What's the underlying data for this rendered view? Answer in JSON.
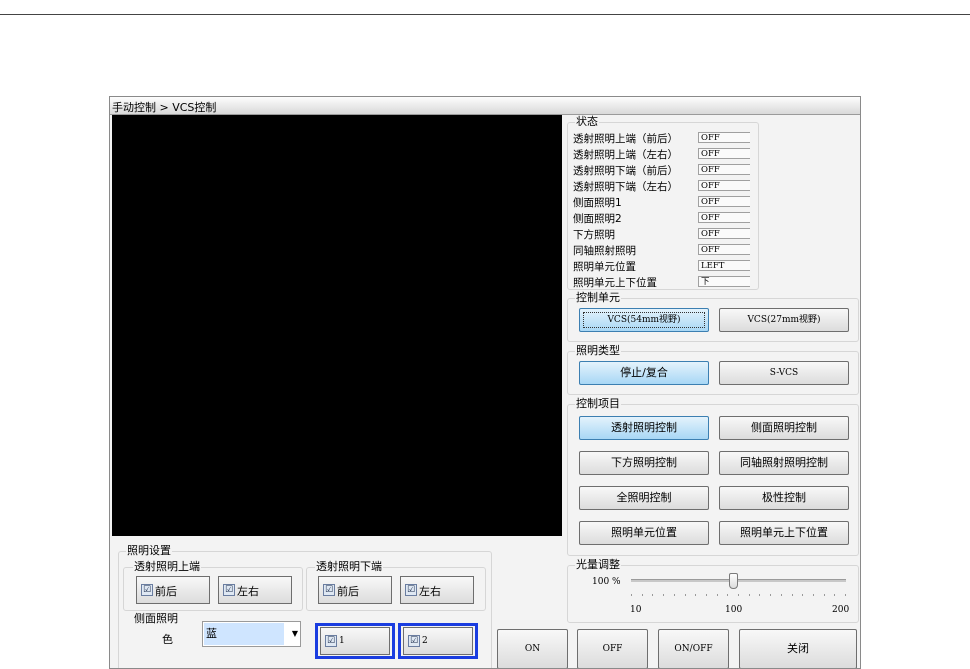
{
  "window": {
    "title": "手动控制 > VCS控制"
  },
  "status": {
    "title": "状态",
    "rows": [
      {
        "label": "透射照明上端（前后）",
        "value": "OFF"
      },
      {
        "label": "透射照明上端（左右）",
        "value": "OFF"
      },
      {
        "label": "透射照明下端（前后）",
        "value": "OFF"
      },
      {
        "label": "透射照明下端（左右）",
        "value": "OFF"
      },
      {
        "label": "侧面照明1",
        "value": "OFF"
      },
      {
        "label": "侧面照明2",
        "value": "OFF"
      },
      {
        "label": "下方照明",
        "value": "OFF"
      },
      {
        "label": "同轴照射照明",
        "value": "OFF"
      },
      {
        "label": "照明单元位置",
        "value": "LEFT"
      },
      {
        "label": "照明单元上下位置",
        "value": "下"
      }
    ]
  },
  "control_unit": {
    "title": "控制单元",
    "btn1": "VCS(54mm视野)",
    "btn2": "VCS(27mm视野)"
  },
  "light_type": {
    "title": "照明类型",
    "btn1": "停止/复合",
    "btn2": "S-VCS"
  },
  "control_items": {
    "title": "控制项目",
    "buttons": [
      "透射照明控制",
      "侧面照明控制",
      "下方照明控制",
      "同轴照射照明控制",
      "全照明控制",
      "极性控制",
      "照明单元位置",
      "照明单元上下位置"
    ]
  },
  "light_adjust": {
    "title": "光量调整",
    "value_text": "100 %",
    "min_label": "10",
    "mid_label": "100",
    "max_label": "200",
    "level": 100
  },
  "light_settings": {
    "title": "照明设置",
    "upper": {
      "title": "透射照明上端",
      "front_back": "前后",
      "left_right": "左右"
    },
    "lower": {
      "title": "透射照明下端",
      "front_back": "前后",
      "left_right": "左右"
    },
    "side": {
      "title": "侧面照明",
      "color_label": "色",
      "color_value": "蓝",
      "chk1": "1",
      "chk2": "2"
    }
  },
  "bottom_buttons": {
    "on": "ON",
    "off": "OFF",
    "onoff": "ON/OFF",
    "close": "关闭"
  },
  "check_mark": "☑"
}
